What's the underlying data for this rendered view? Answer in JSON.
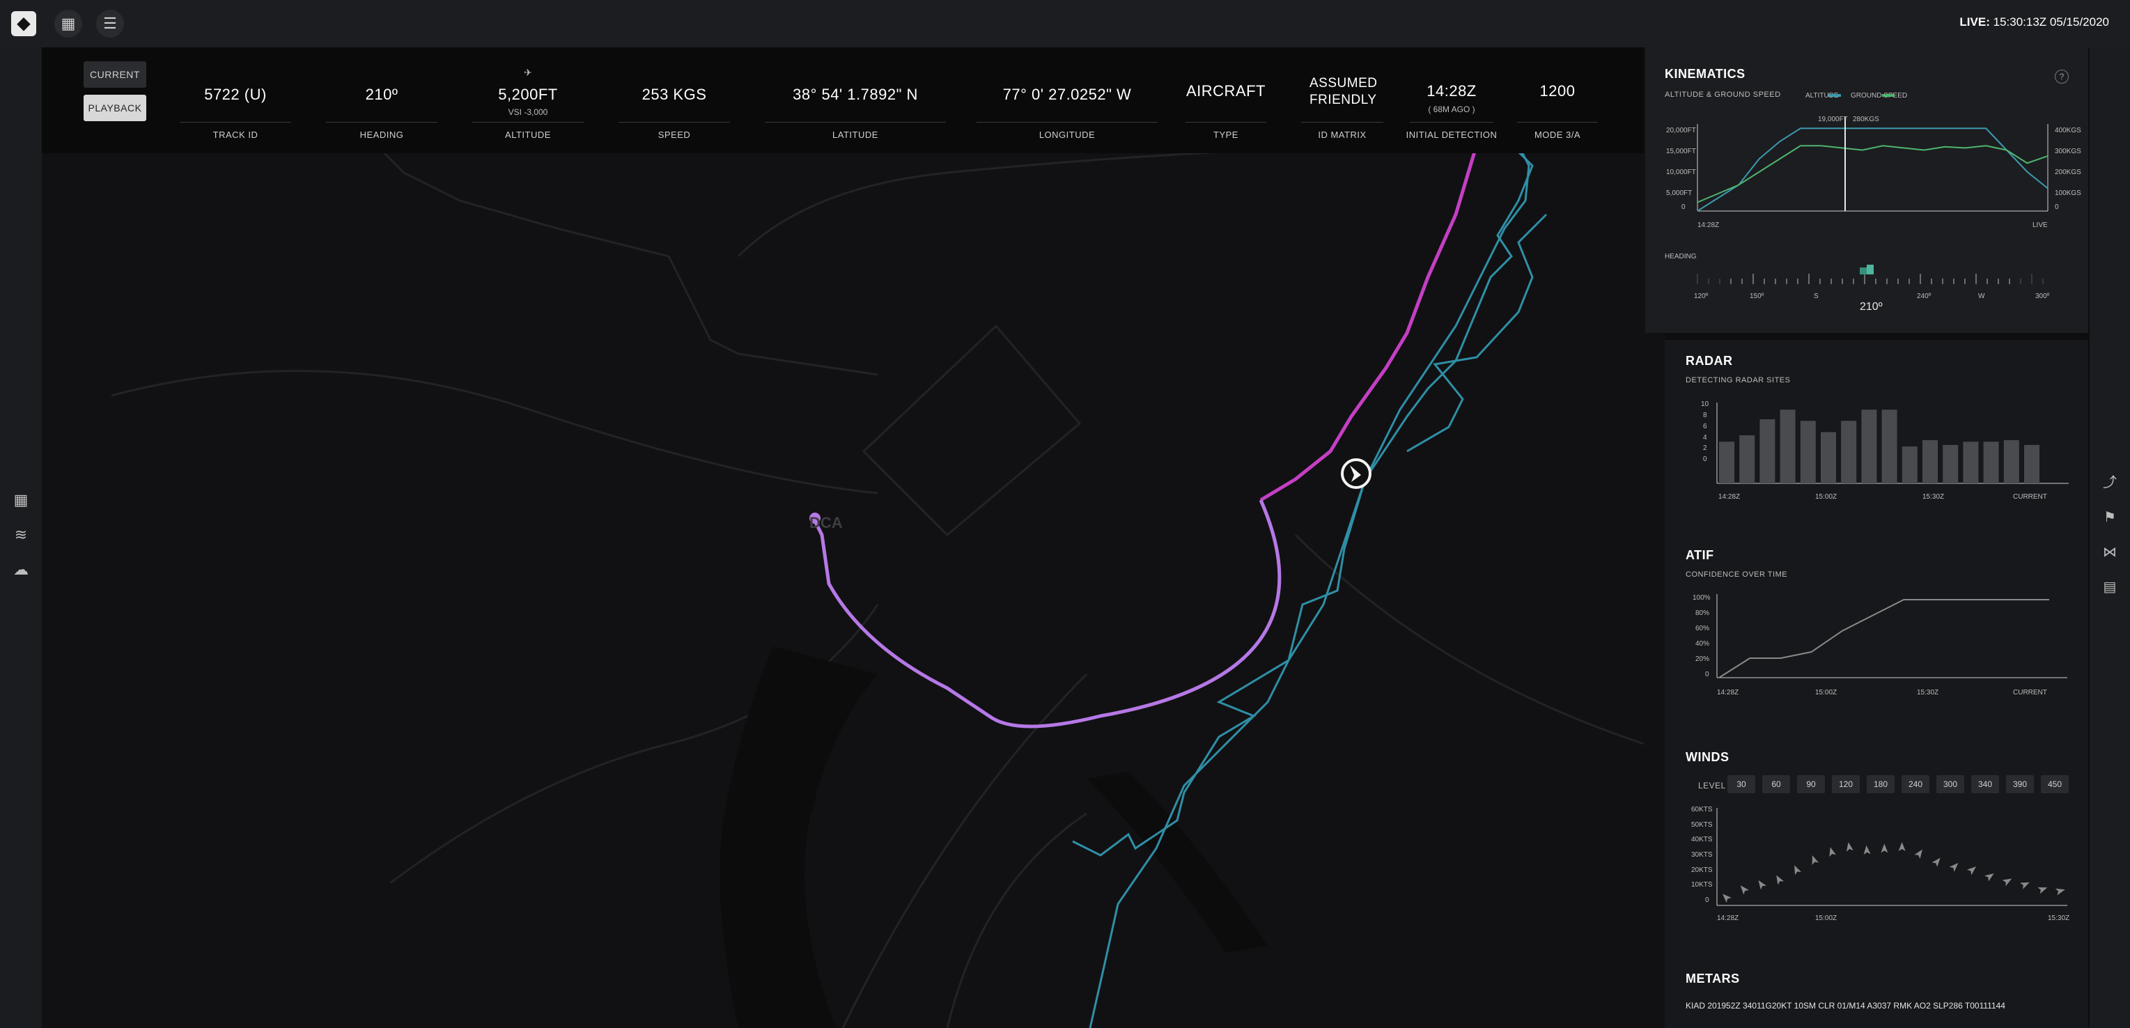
{
  "live": {
    "label": "LIVE:",
    "time": "15:30:13Z",
    "date": "05/15/2020"
  },
  "mode": {
    "current": "CURRENT",
    "playback": "PLAYBACK"
  },
  "fields": [
    {
      "value": "5722 (U)",
      "label": "TRACK ID",
      "sub": ""
    },
    {
      "value": "210º",
      "label": "HEADING",
      "sub": ""
    },
    {
      "value": "5,200FT",
      "label": "ALTITUDE",
      "sub": "VSI -3,000"
    },
    {
      "value": "253 KGS",
      "label": "SPEED",
      "sub": ""
    },
    {
      "value": "38° 54' 1.7892\" N",
      "label": "LATITUDE",
      "sub": ""
    },
    {
      "value": "77° 0' 27.0252\" W",
      "label": "LONGITUDE",
      "sub": ""
    },
    {
      "value": "AIRCRAFT",
      "label": "TYPE",
      "sub": ""
    },
    {
      "value": "ASSUMED FRIENDLY",
      "label": "ID MATRIX",
      "sub": ""
    },
    {
      "value": "14:28Z",
      "label": "INITIAL DETECTION",
      "sub": "( 68M AGO )"
    },
    {
      "value": "1200",
      "label": "MODE 3/A",
      "sub": ""
    }
  ],
  "map": {
    "airport_label": "DCA"
  },
  "colors": {
    "track_magenta": "#c43fc4",
    "track_purple": "#b678e6",
    "radar_teal": "#2f8fa6",
    "groundspeed_green": "#4fb56f",
    "altitude_teal": "#3b9ab0"
  },
  "kinematics": {
    "title": "KINEMATICS",
    "subtitle": "ALTITUDE & GROUND SPEED",
    "legend_altitude": "ALTITUDE",
    "legend_groundspeed": "GROUND SPEED",
    "cursor_alt": "19,000FT",
    "cursor_speed": "280KGS",
    "y_left": [
      "20,000FT",
      "15,000FT",
      "10,000FT",
      "5,000FT",
      "0"
    ],
    "y_right": [
      "400KGS",
      "300KGS",
      "200KGS",
      "100KGS",
      "0"
    ],
    "x_start": "14:28Z",
    "x_end": "LIVE",
    "heading_label": "HEADING",
    "heading_ticks": [
      "120º",
      "150º",
      "S",
      "240º",
      "W",
      "300º"
    ],
    "heading_value": "210º"
  },
  "radar": {
    "title": "RADAR",
    "subtitle": "DETECTING RADAR SITES",
    "x_labels": [
      "14:28Z",
      "15:00Z",
      "15:30Z",
      "CURRENT"
    ],
    "y_ticks": [
      "10",
      "8",
      "6",
      "4",
      "2",
      "0"
    ]
  },
  "atif": {
    "title": "ATIF",
    "subtitle": "CONFIDENCE OVER TIME",
    "x_labels": [
      "14:28Z",
      "15:00Z",
      "15:30Z",
      "CURRENT"
    ],
    "y_ticks": [
      "100%",
      "80%",
      "60%",
      "40%",
      "20%",
      "0"
    ]
  },
  "winds": {
    "title": "WINDS",
    "level_label": "LEVEL",
    "levels": [
      "30",
      "60",
      "90",
      "120",
      "180",
      "240",
      "300",
      "340",
      "390",
      "450"
    ],
    "y_ticks": [
      "60KTS",
      "50KTS",
      "40KTS",
      "30KTS",
      "20KTS",
      "10KTS",
      "0"
    ],
    "x_labels": [
      "14:28Z",
      "15:00Z",
      "15:30Z"
    ]
  },
  "metars": {
    "title": "METARS",
    "text": "KIAD 201952Z 34011G20KT 10SM CLR 01/M14 A3037 RMK AO2 SLP286 T00111144"
  },
  "chart_data": [
    {
      "type": "line",
      "title": "KINEMATICS",
      "x_range": [
        "14:28Z",
        "LIVE"
      ],
      "series": [
        {
          "name": "ALTITUDE",
          "axis": "left",
          "values": [
            0,
            3000,
            6000,
            12000,
            16000,
            19000,
            19000,
            19000,
            19000,
            19000,
            19000,
            19000,
            19000,
            19000,
            19000,
            14000,
            9000,
            5200
          ]
        },
        {
          "name": "GROUND SPEED",
          "axis": "right",
          "values": [
            40,
            80,
            120,
            180,
            240,
            300,
            300,
            290,
            280,
            300,
            290,
            280,
            295,
            290,
            300,
            280,
            220,
            253
          ]
        }
      ],
      "ylim_left": [
        0,
        20000
      ],
      "ylim_right": [
        0,
        400
      ]
    },
    {
      "type": "bar",
      "title": "RADAR",
      "values": [
        5.2,
        6,
        8,
        9.2,
        7.8,
        6.4,
        7.8,
        9.2,
        9.2,
        4.6,
        5.4,
        4.8,
        5.2,
        5.2,
        5.4,
        4.8
      ],
      "ylim": [
        0,
        10
      ]
    },
    {
      "type": "line",
      "title": "ATIF",
      "x": [
        0,
        1,
        2,
        3,
        4,
        5,
        6,
        7,
        8,
        9,
        10
      ],
      "values": [
        0,
        25,
        25,
        33,
        60,
        80,
        100,
        100,
        100,
        100,
        100
      ],
      "ylim": [
        0,
        100
      ]
    },
    {
      "type": "scatter",
      "title": "WINDS",
      "values": [
        5,
        10,
        13,
        16,
        22,
        28,
        33,
        36,
        34,
        35,
        36,
        32,
        27,
        24,
        22,
        18,
        15,
        13,
        10,
        9
      ],
      "ylim": [
        0,
        60
      ]
    }
  ]
}
